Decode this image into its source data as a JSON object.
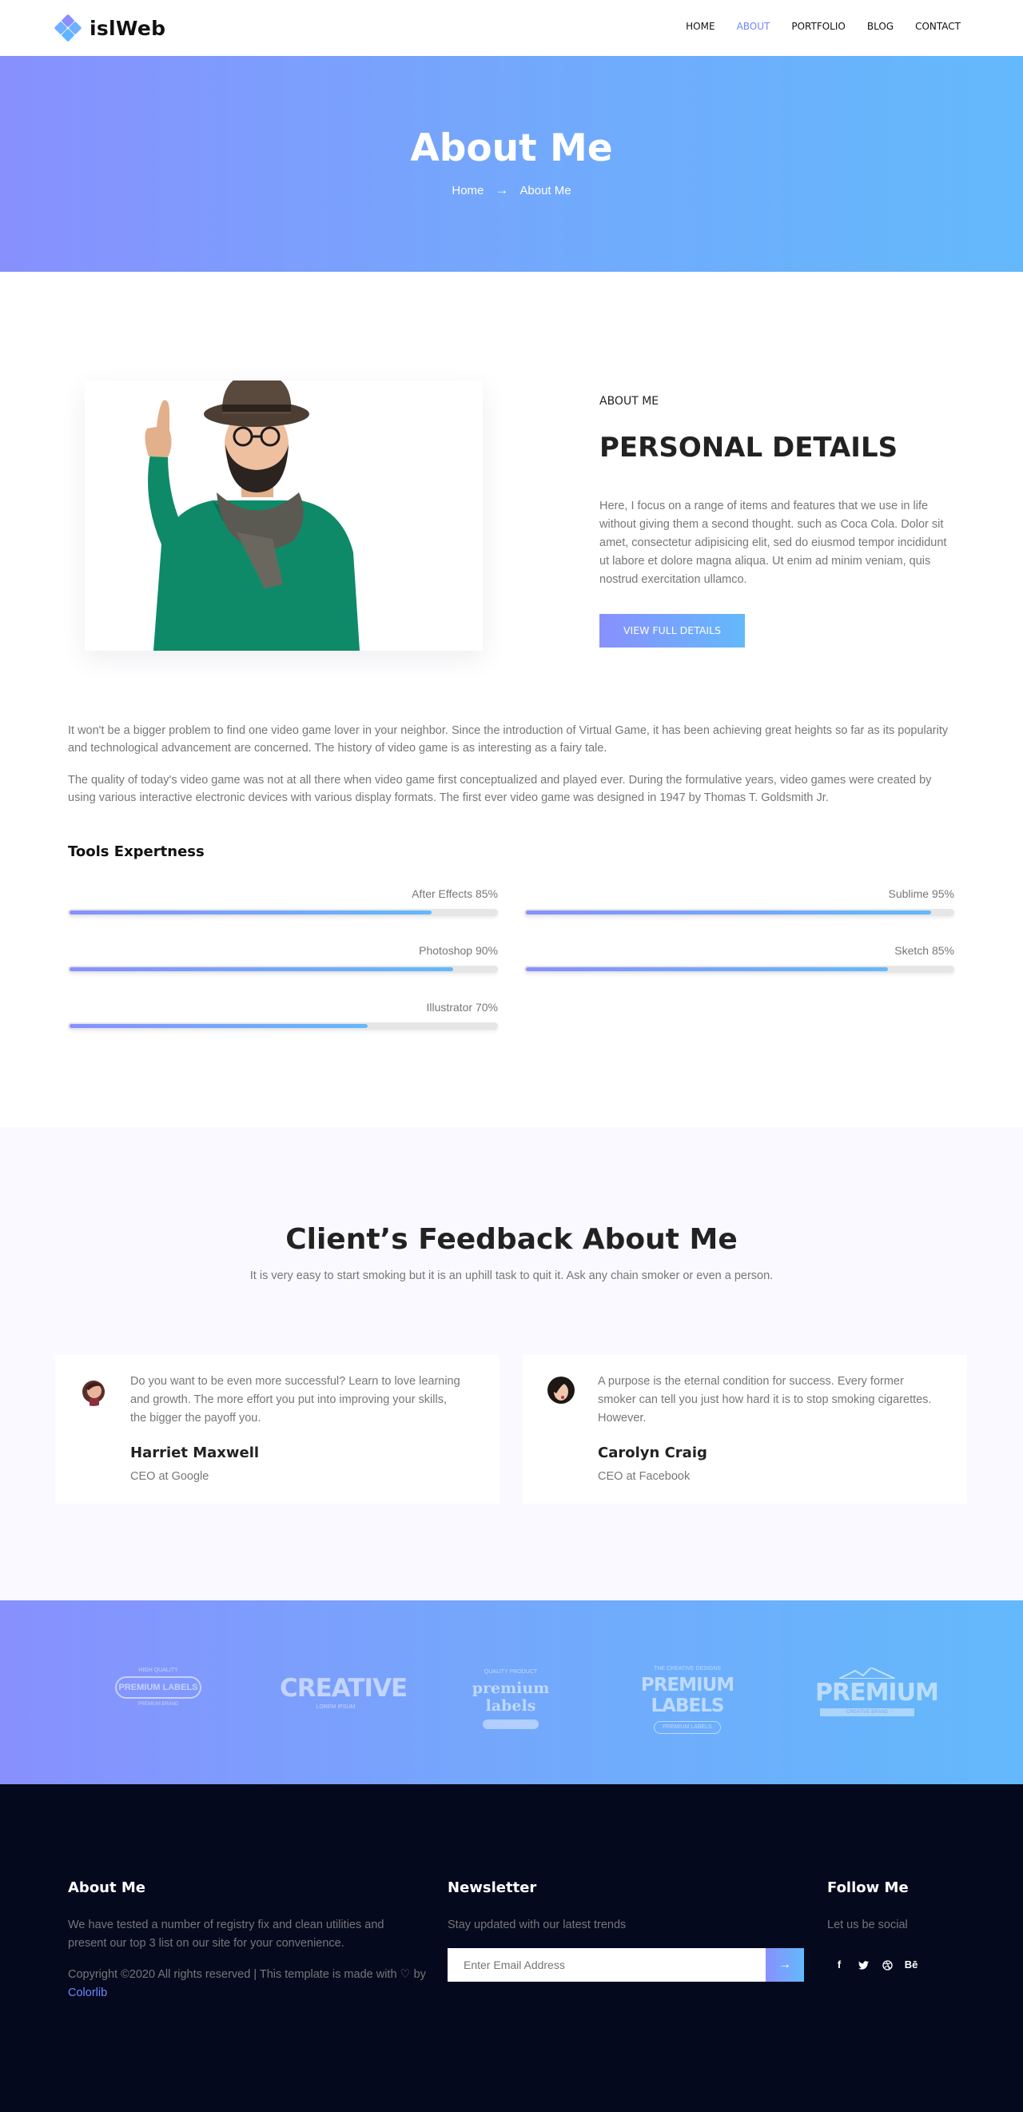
{
  "header": {
    "logo_text": "islWeb",
    "nav": [
      "HOME",
      "ABOUT",
      "PORTFOLIO",
      "BLOG",
      "CONTACT"
    ],
    "active_nav": "ABOUT"
  },
  "banner": {
    "title": "About Me",
    "crumb_home": "Home",
    "crumb_arrow": "→",
    "crumb_current": "About Me"
  },
  "about": {
    "kicker": "ABOUT ME",
    "title": "PERSONAL DETAILS",
    "text": "Here, I focus on a range of items and features that we use in life without giving them a second thought. such as Coca Cola. Dolor sit amet, consectetur adipisicing elit, sed do eiusmod tempor incididunt ut labore et dolore magna aliqua. Ut enim ad minim veniam, quis nostrud exercitation ullamco.",
    "button": "VIEW FULL DETAILS",
    "para1": "It won't be a bigger problem to find one video game lover in your neighbor. Since the introduction of Virtual Game, it has been achieving great heights so far as its popularity and technological advancement are concerned. The history of video game is as interesting as a fairy tale.",
    "para2": "The quality of today's video game was not at all there when video game first conceptualized and played ever. During the formulative years, video games were created by using various interactive electronic devices with various display formats. The first ever video game was designed in 1947 by Thomas T. Goldsmith Jr."
  },
  "tools": {
    "title": "Tools Expertness",
    "skills": [
      {
        "label": "After Effects 85%",
        "percent": 85
      },
      {
        "label": "Sublime 95%",
        "percent": 95
      },
      {
        "label": "Photoshop 90%",
        "percent": 90
      },
      {
        "label": "Sketch 85%",
        "percent": 85
      },
      {
        "label": "Illustrator 70%",
        "percent": 70
      }
    ]
  },
  "feedback": {
    "title": "Client’s Feedback About Me",
    "subtitle": "It is very easy to start smoking but it is an uphill task to quit it. Ask any chain smoker or even a person.",
    "cards": [
      {
        "quote": "Do you want to be even more successful? Learn to love learning and growth. The more effort you put into improving your skills, the bigger the payoff you.",
        "name": "Harriet Maxwell",
        "role": "CEO at Google"
      },
      {
        "quote": "A purpose is the eternal condition for success. Every former smoker can tell you just how hard it is to stop smoking cigarettes. However.",
        "name": "Carolyn Craig",
        "role": "CEO at Facebook"
      }
    ]
  },
  "brands": {
    "b1_top": "HIGH QUALITY",
    "b1_main": "PREMIUM LABELS",
    "b1_bottom": "PREMIUM BRAND",
    "b2_main": "CREATIVE",
    "b2_sub": "LOREM IPSUM",
    "b3_top": "QUALITY PRODUCT",
    "b3_main": "premium labels",
    "b4_top": "THE CREATIVE DESIGNS",
    "b4_main": "PREMIUM LABELS",
    "b4_sub": "PREMIUM LABELS",
    "b5_main": "PREMIUM",
    "b5_sub": "CREATIVE BRAND"
  },
  "footer": {
    "about_title": "About Me",
    "about_text": "We have tested a number of registry fix and clean utilities and present our top 3 list on our site for your convenience.",
    "copyright": "Copyright ©2020 All rights reserved | This template is made with ♡ by",
    "copyright_link": "Colorlib",
    "newsletter_title": "Newsletter",
    "newsletter_text": "Stay updated with our latest trends",
    "newsletter_placeholder": "Enter Email Address",
    "newsletter_button": "→",
    "follow_title": "Follow Me",
    "follow_text": "Let us be social",
    "social": [
      "f",
      "t",
      "d",
      "Bē"
    ]
  },
  "colors": {
    "accent_start": "#8890fe",
    "accent_end": "#63b9fb",
    "footer_bg": "#04091e",
    "feedback_bg": "#f9f9ff"
  }
}
